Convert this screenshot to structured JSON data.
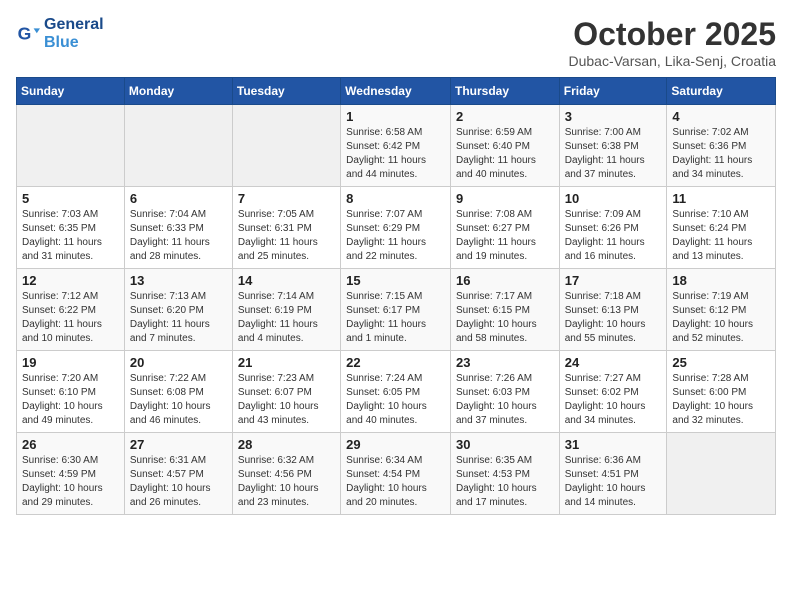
{
  "header": {
    "logo_line1": "General",
    "logo_line2": "Blue",
    "month": "October 2025",
    "location": "Dubac-Varsan, Lika-Senj, Croatia"
  },
  "days_of_week": [
    "Sunday",
    "Monday",
    "Tuesday",
    "Wednesday",
    "Thursday",
    "Friday",
    "Saturday"
  ],
  "weeks": [
    [
      {
        "day": "",
        "info": ""
      },
      {
        "day": "",
        "info": ""
      },
      {
        "day": "",
        "info": ""
      },
      {
        "day": "1",
        "info": "Sunrise: 6:58 AM\nSunset: 6:42 PM\nDaylight: 11 hours\nand 44 minutes."
      },
      {
        "day": "2",
        "info": "Sunrise: 6:59 AM\nSunset: 6:40 PM\nDaylight: 11 hours\nand 40 minutes."
      },
      {
        "day": "3",
        "info": "Sunrise: 7:00 AM\nSunset: 6:38 PM\nDaylight: 11 hours\nand 37 minutes."
      },
      {
        "day": "4",
        "info": "Sunrise: 7:02 AM\nSunset: 6:36 PM\nDaylight: 11 hours\nand 34 minutes."
      }
    ],
    [
      {
        "day": "5",
        "info": "Sunrise: 7:03 AM\nSunset: 6:35 PM\nDaylight: 11 hours\nand 31 minutes."
      },
      {
        "day": "6",
        "info": "Sunrise: 7:04 AM\nSunset: 6:33 PM\nDaylight: 11 hours\nand 28 minutes."
      },
      {
        "day": "7",
        "info": "Sunrise: 7:05 AM\nSunset: 6:31 PM\nDaylight: 11 hours\nand 25 minutes."
      },
      {
        "day": "8",
        "info": "Sunrise: 7:07 AM\nSunset: 6:29 PM\nDaylight: 11 hours\nand 22 minutes."
      },
      {
        "day": "9",
        "info": "Sunrise: 7:08 AM\nSunset: 6:27 PM\nDaylight: 11 hours\nand 19 minutes."
      },
      {
        "day": "10",
        "info": "Sunrise: 7:09 AM\nSunset: 6:26 PM\nDaylight: 11 hours\nand 16 minutes."
      },
      {
        "day": "11",
        "info": "Sunrise: 7:10 AM\nSunset: 6:24 PM\nDaylight: 11 hours\nand 13 minutes."
      }
    ],
    [
      {
        "day": "12",
        "info": "Sunrise: 7:12 AM\nSunset: 6:22 PM\nDaylight: 11 hours\nand 10 minutes."
      },
      {
        "day": "13",
        "info": "Sunrise: 7:13 AM\nSunset: 6:20 PM\nDaylight: 11 hours\nand 7 minutes."
      },
      {
        "day": "14",
        "info": "Sunrise: 7:14 AM\nSunset: 6:19 PM\nDaylight: 11 hours\nand 4 minutes."
      },
      {
        "day": "15",
        "info": "Sunrise: 7:15 AM\nSunset: 6:17 PM\nDaylight: 11 hours\nand 1 minute."
      },
      {
        "day": "16",
        "info": "Sunrise: 7:17 AM\nSunset: 6:15 PM\nDaylight: 10 hours\nand 58 minutes."
      },
      {
        "day": "17",
        "info": "Sunrise: 7:18 AM\nSunset: 6:13 PM\nDaylight: 10 hours\nand 55 minutes."
      },
      {
        "day": "18",
        "info": "Sunrise: 7:19 AM\nSunset: 6:12 PM\nDaylight: 10 hours\nand 52 minutes."
      }
    ],
    [
      {
        "day": "19",
        "info": "Sunrise: 7:20 AM\nSunset: 6:10 PM\nDaylight: 10 hours\nand 49 minutes."
      },
      {
        "day": "20",
        "info": "Sunrise: 7:22 AM\nSunset: 6:08 PM\nDaylight: 10 hours\nand 46 minutes."
      },
      {
        "day": "21",
        "info": "Sunrise: 7:23 AM\nSunset: 6:07 PM\nDaylight: 10 hours\nand 43 minutes."
      },
      {
        "day": "22",
        "info": "Sunrise: 7:24 AM\nSunset: 6:05 PM\nDaylight: 10 hours\nand 40 minutes."
      },
      {
        "day": "23",
        "info": "Sunrise: 7:26 AM\nSunset: 6:03 PM\nDaylight: 10 hours\nand 37 minutes."
      },
      {
        "day": "24",
        "info": "Sunrise: 7:27 AM\nSunset: 6:02 PM\nDaylight: 10 hours\nand 34 minutes."
      },
      {
        "day": "25",
        "info": "Sunrise: 7:28 AM\nSunset: 6:00 PM\nDaylight: 10 hours\nand 32 minutes."
      }
    ],
    [
      {
        "day": "26",
        "info": "Sunrise: 6:30 AM\nSunset: 4:59 PM\nDaylight: 10 hours\nand 29 minutes."
      },
      {
        "day": "27",
        "info": "Sunrise: 6:31 AM\nSunset: 4:57 PM\nDaylight: 10 hours\nand 26 minutes."
      },
      {
        "day": "28",
        "info": "Sunrise: 6:32 AM\nSunset: 4:56 PM\nDaylight: 10 hours\nand 23 minutes."
      },
      {
        "day": "29",
        "info": "Sunrise: 6:34 AM\nSunset: 4:54 PM\nDaylight: 10 hours\nand 20 minutes."
      },
      {
        "day": "30",
        "info": "Sunrise: 6:35 AM\nSunset: 4:53 PM\nDaylight: 10 hours\nand 17 minutes."
      },
      {
        "day": "31",
        "info": "Sunrise: 6:36 AM\nSunset: 4:51 PM\nDaylight: 10 hours\nand 14 minutes."
      },
      {
        "day": "",
        "info": ""
      }
    ]
  ]
}
